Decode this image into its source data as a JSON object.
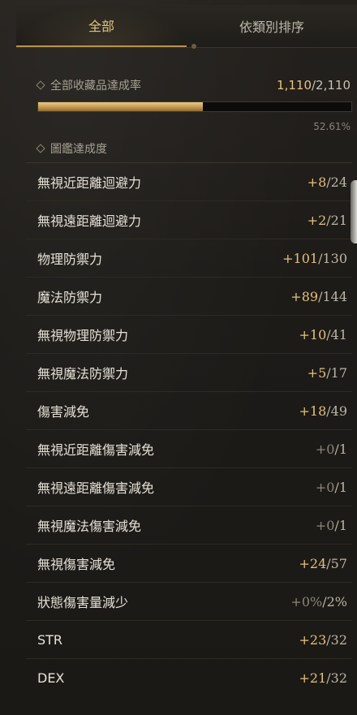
{
  "tabs": [
    {
      "label": "全部",
      "active": true
    },
    {
      "label": "依類別排序",
      "active": false
    }
  ],
  "summary": {
    "label": "全部收藏品達成率",
    "current": "1,110",
    "total": "/2,110",
    "percent_text": "52.61%",
    "progress": 0.5261
  },
  "section_title": "圖鑑達成度",
  "items": [
    {
      "label": "無視近距離迴避力",
      "bonus": "+8",
      "max": "/24"
    },
    {
      "label": "無視遠距離迴避力",
      "bonus": "+2",
      "max": "/21"
    },
    {
      "label": "物理防禦力",
      "bonus": "+101",
      "max": "/130"
    },
    {
      "label": "魔法防禦力",
      "bonus": "+89",
      "max": "/144"
    },
    {
      "label": "無視物理防禦力",
      "bonus": "+10",
      "max": "/41"
    },
    {
      "label": "無視魔法防禦力",
      "bonus": "+5",
      "max": "/17"
    },
    {
      "label": "傷害減免",
      "bonus": "+18",
      "max": "/49"
    },
    {
      "label": "無視近距離傷害減免",
      "bonus": "+0",
      "max": "/1"
    },
    {
      "label": "無視遠距離傷害減免",
      "bonus": "+0",
      "max": "/1"
    },
    {
      "label": "無視魔法傷害減免",
      "bonus": "+0",
      "max": "/1"
    },
    {
      "label": "無視傷害減免",
      "bonus": "+24",
      "max": "/57"
    },
    {
      "label": "狀態傷害量減少",
      "bonus": "+0%",
      "max": "/2%"
    },
    {
      "label": "STR",
      "bonus": "+23",
      "max": "/32"
    },
    {
      "label": "DEX",
      "bonus": "+21",
      "max": "/32"
    }
  ],
  "colors": {
    "accent": "#e3c27b",
    "bonus": "#e6c07a",
    "background": "#1c1a17"
  }
}
